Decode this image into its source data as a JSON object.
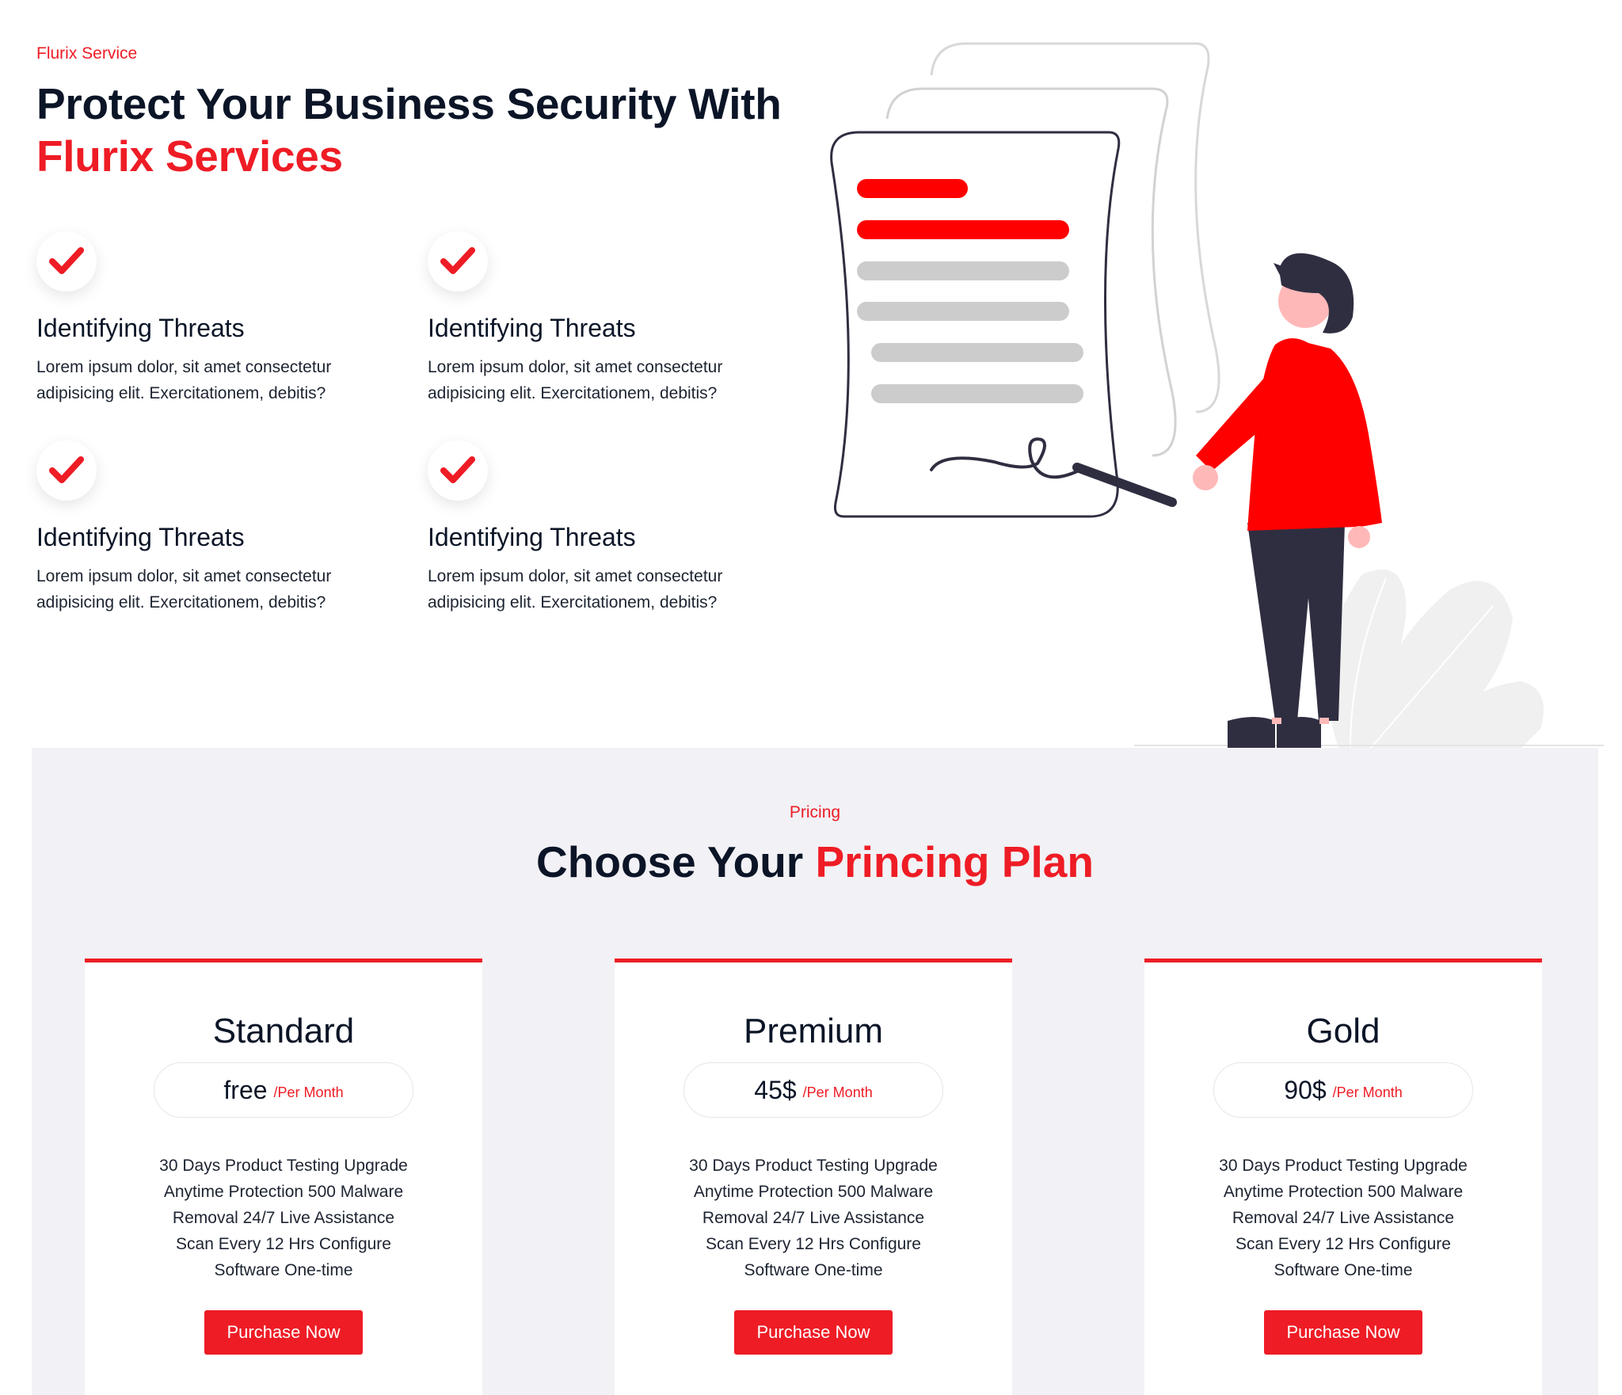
{
  "services": {
    "eyebrow": "Flurix Service",
    "title_line1": "Protect Your Business Security With",
    "title_line2": "Flurix Services",
    "features": [
      {
        "icon": "check-icon",
        "title": "Identifying Threats",
        "text": "Lorem ipsum dolor, sit amet consectetur adipisicing elit. Exercitationem, debitis?"
      },
      {
        "icon": "check-icon",
        "title": "Identifying Threats",
        "text": "Lorem ipsum dolor, sit amet consectetur adipisicing elit. Exercitationem, debitis?"
      },
      {
        "icon": "check-icon",
        "title": "Identifying Threats",
        "text": "Lorem ipsum dolor, sit amet consectetur adipisicing elit. Exercitationem, debitis?"
      },
      {
        "icon": "check-icon",
        "title": "Identifying Threats",
        "text": "Lorem ipsum dolor, sit amet consectetur adipisicing elit. Exercitationem, debitis?"
      }
    ]
  },
  "pricing": {
    "eyebrow": "Pricing",
    "title_plain": "Choose Your ",
    "title_accent": "Princing Plan",
    "plans": [
      {
        "name": "Standard",
        "price": "free",
        "period": "/Per Month",
        "features": [
          "30 Days Product Testing Upgrade",
          "Anytime Protection 500 Malware",
          "Removal 24/7 Live Assistance",
          "Scan Every 12 Hrs Configure",
          "Software One-time"
        ],
        "button": "Purchase Now"
      },
      {
        "name": "Premium",
        "price": "45$",
        "period": "/Per Month",
        "features": [
          "30 Days Product Testing Upgrade",
          "Anytime Protection 500 Malware",
          "Removal 24/7 Live Assistance",
          "Scan Every 12 Hrs Configure",
          "Software One-time"
        ],
        "button": "Purchase Now"
      },
      {
        "name": "Gold",
        "price": "90$",
        "period": "/Per Month",
        "features": [
          "30 Days Product Testing Upgrade",
          "Anytime Protection 500 Malware",
          "Removal 24/7 Live Assistance",
          "Scan Every 12 Hrs Configure",
          "Software One-time"
        ],
        "button": "Purchase Now"
      }
    ]
  },
  "colors": {
    "accent": "#ee1c25",
    "dark": "#0b1527",
    "section_bg": "#f2f1f5"
  },
  "illustration": {
    "icon": "signing-document-illustration"
  }
}
